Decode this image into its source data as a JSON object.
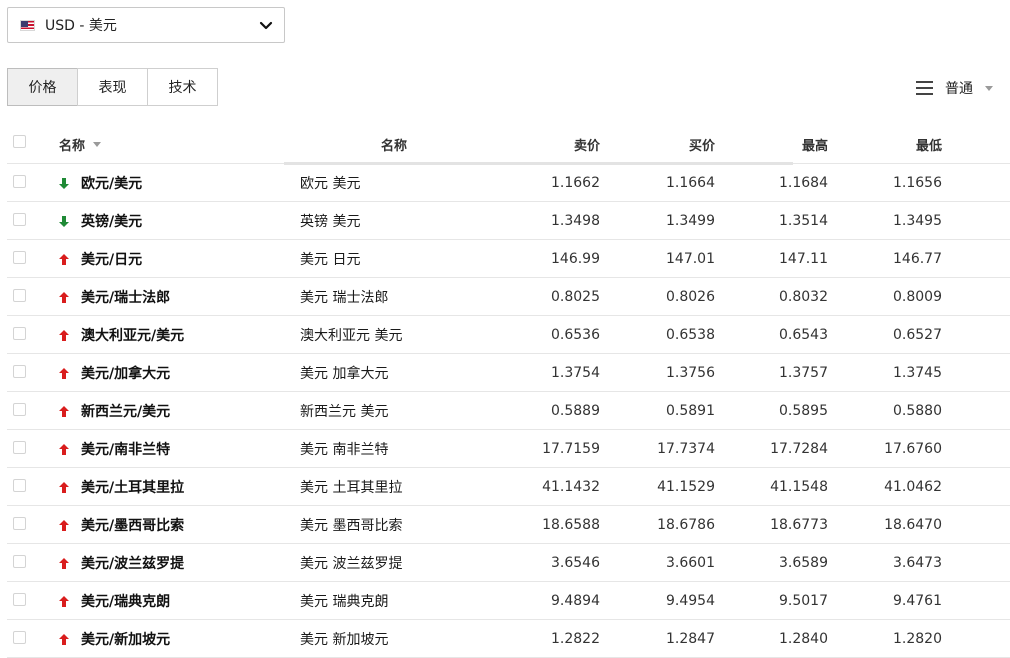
{
  "currency_selector": {
    "label": "USD - 美元",
    "flag_icon": "us-flag-icon",
    "chevron_icon": "chevron-down-icon"
  },
  "tabs": [
    {
      "label": "价格",
      "active": true
    },
    {
      "label": "表现",
      "active": false
    },
    {
      "label": "技术",
      "active": false
    }
  ],
  "view": {
    "label": "普通",
    "icon": "menu-lines-icon"
  },
  "colors": {
    "up": "#d91d1d",
    "down": "#1f8a36"
  },
  "table": {
    "headers": {
      "name": "名称",
      "name2": "名称",
      "bid": "卖价",
      "ask": "买价",
      "high": "最高",
      "low": "最低"
    },
    "rows": [
      {
        "dir": "down",
        "name": "欧元/美元",
        "name2": "欧元 美元",
        "bid": "1.1662",
        "ask": "1.1664",
        "high": "1.1684",
        "low": "1.1656"
      },
      {
        "dir": "down",
        "name": "英镑/美元",
        "name2": "英镑 美元",
        "bid": "1.3498",
        "ask": "1.3499",
        "high": "1.3514",
        "low": "1.3495"
      },
      {
        "dir": "up",
        "name": "美元/日元",
        "name2": "美元 日元",
        "bid": "146.99",
        "ask": "147.01",
        "high": "147.11",
        "low": "146.77"
      },
      {
        "dir": "up",
        "name": "美元/瑞士法郎",
        "name2": "美元 瑞士法郎",
        "bid": "0.8025",
        "ask": "0.8026",
        "high": "0.8032",
        "low": "0.8009"
      },
      {
        "dir": "up",
        "name": "澳大利亚元/美元",
        "name2": "澳大利亚元 美元",
        "bid": "0.6536",
        "ask": "0.6538",
        "high": "0.6543",
        "low": "0.6527"
      },
      {
        "dir": "up",
        "name": "美元/加拿大元",
        "name2": "美元 加拿大元",
        "bid": "1.3754",
        "ask": "1.3756",
        "high": "1.3757",
        "low": "1.3745"
      },
      {
        "dir": "up",
        "name": "新西兰元/美元",
        "name2": "新西兰元 美元",
        "bid": "0.5889",
        "ask": "0.5891",
        "high": "0.5895",
        "low": "0.5880"
      },
      {
        "dir": "up",
        "name": "美元/南非兰特",
        "name2": "美元 南非兰特",
        "bid": "17.7159",
        "ask": "17.7374",
        "high": "17.7284",
        "low": "17.6760"
      },
      {
        "dir": "up",
        "name": "美元/土耳其里拉",
        "name2": "美元 土耳其里拉",
        "bid": "41.1432",
        "ask": "41.1529",
        "high": "41.1548",
        "low": "41.0462"
      },
      {
        "dir": "up",
        "name": "美元/墨西哥比索",
        "name2": "美元 墨西哥比索",
        "bid": "18.6588",
        "ask": "18.6786",
        "high": "18.6773",
        "low": "18.6470"
      },
      {
        "dir": "up",
        "name": "美元/波兰兹罗提",
        "name2": "美元 波兰兹罗提",
        "bid": "3.6546",
        "ask": "3.6601",
        "high": "3.6589",
        "low": "3.6473"
      },
      {
        "dir": "up",
        "name": "美元/瑞典克朗",
        "name2": "美元 瑞典克朗",
        "bid": "9.4894",
        "ask": "9.4954",
        "high": "9.5017",
        "low": "9.4761"
      },
      {
        "dir": "up",
        "name": "美元/新加坡元",
        "name2": "美元 新加坡元",
        "bid": "1.2822",
        "ask": "1.2847",
        "high": "1.2840",
        "low": "1.2820"
      }
    ]
  }
}
